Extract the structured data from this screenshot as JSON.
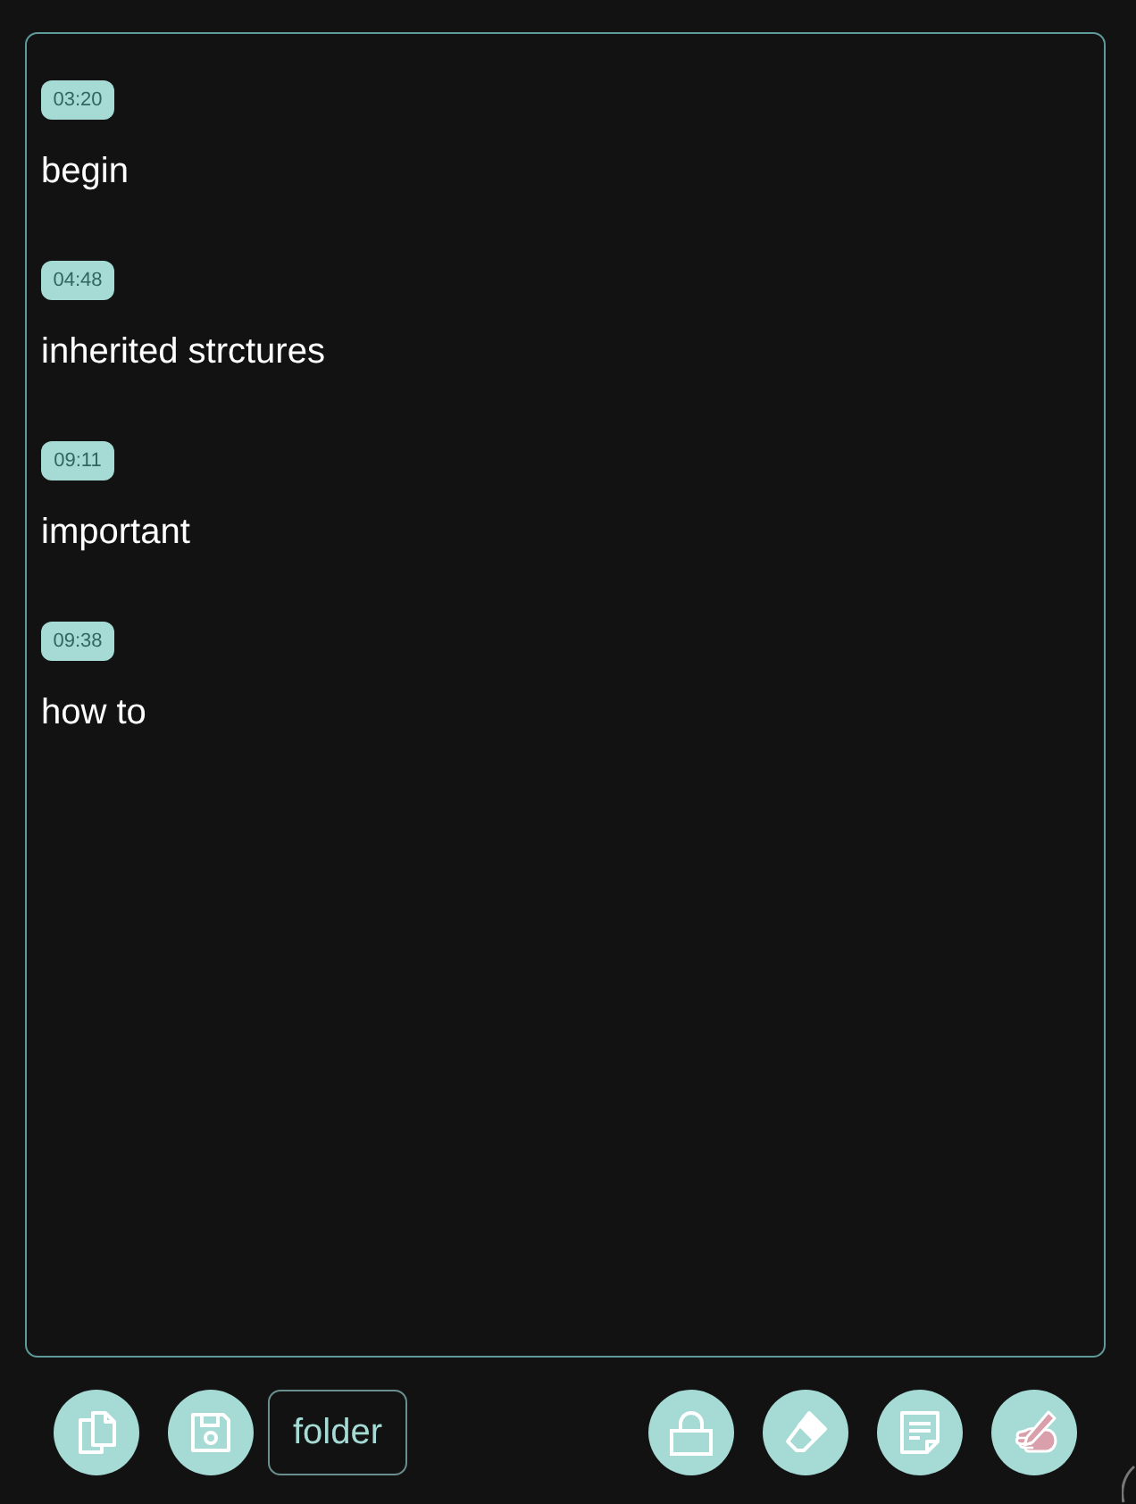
{
  "entries": [
    {
      "time": "03:20",
      "title": "begin"
    },
    {
      "time": "04:48",
      "title": "inherited strctures"
    },
    {
      "time": "09:11",
      "title": "important"
    },
    {
      "time": "09:38",
      "title": "how to"
    }
  ],
  "toolbar": {
    "left": [
      {
        "kind": "copy"
      },
      {
        "kind": "save"
      }
    ],
    "folder_label": "folder",
    "right": [
      {
        "kind": "lock"
      },
      {
        "kind": "eraser"
      },
      {
        "kind": "note"
      },
      {
        "kind": "sign"
      }
    ]
  }
}
